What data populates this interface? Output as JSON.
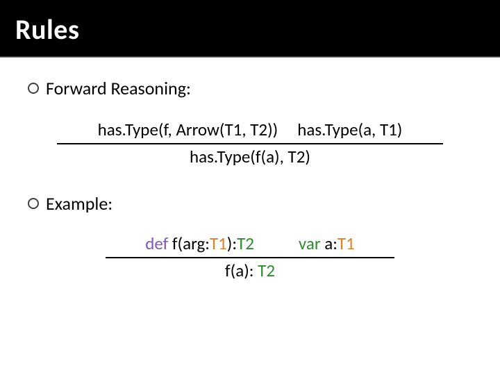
{
  "title": "Rules",
  "bullets": {
    "b1": "Forward Reasoning:",
    "b2": "Example:"
  },
  "inference1": {
    "premise1": "has.Type(f, Arrow(T1, T2))",
    "premise2": "has.Type(a, T1)",
    "conclusion": "has.Type(f(a), T2)"
  },
  "inference2": {
    "p1": {
      "def": "def ",
      "f": "f",
      "lp": "(arg:",
      "t1": "T1",
      "rp": "):",
      "t2": "T2"
    },
    "p2": {
      "var": "var ",
      "a": "a",
      "colon": ":",
      "t1": "T1"
    },
    "c": {
      "f": "f",
      "lp": "(",
      "a": "a",
      "rp": "): ",
      "t2": "T2"
    }
  }
}
